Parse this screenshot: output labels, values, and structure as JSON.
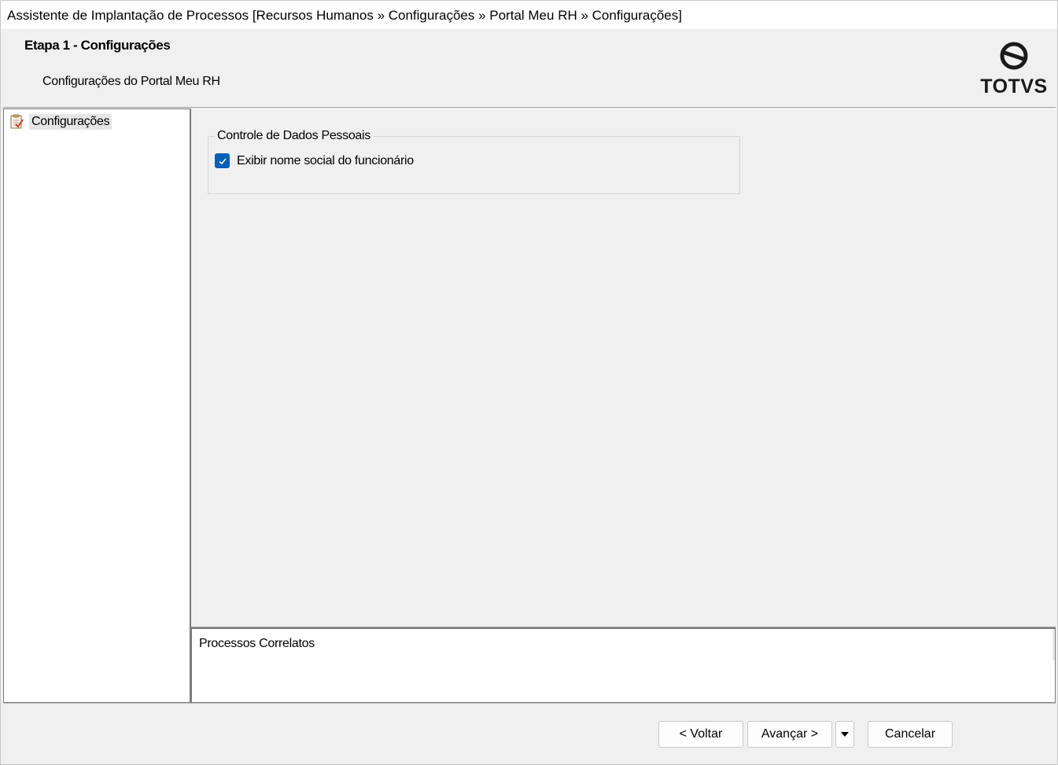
{
  "window": {
    "title": "Assistente de Implantação de Processos [Recursos Humanos » Configurações » Portal Meu RH » Configurações]"
  },
  "header": {
    "step_title": "Etapa 1 - Configurações",
    "step_subtitle": "Configurações do Portal Meu RH",
    "logo_text": "TOTVS"
  },
  "tree": {
    "items": [
      {
        "label": "Configurações",
        "icon": "checklist-icon",
        "selected": true
      }
    ]
  },
  "main": {
    "group": {
      "legend": "Controle de Dados Pessoais",
      "checkbox_label": "Exibir nome social do funcionário",
      "checked": true
    }
  },
  "correlated": {
    "label": "Processos Correlatos"
  },
  "footer": {
    "back_label": "< Voltar",
    "next_label": "Avançar >",
    "cancel_label": "Cancelar"
  },
  "colors": {
    "accent": "#005fb8",
    "background": "#f0f0f0"
  }
}
